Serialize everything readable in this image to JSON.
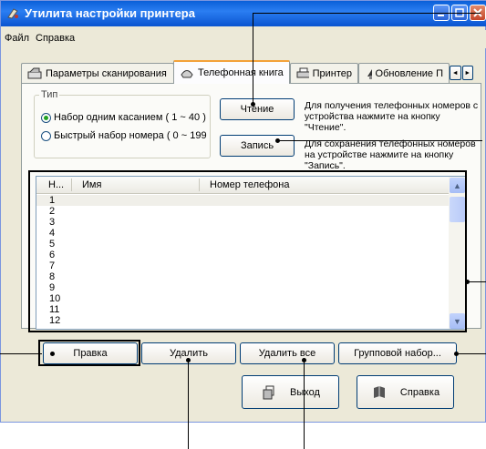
{
  "window": {
    "title": "Утилита настройки принтера"
  },
  "menu": [
    "Файл",
    "Справка"
  ],
  "tabs": [
    {
      "label": "Параметры сканирования",
      "icon": "scanner-icon"
    },
    {
      "label": "Телефонная книга",
      "icon": "phonebook-icon",
      "active": true
    },
    {
      "label": "Принтер",
      "icon": "printer-icon"
    },
    {
      "label": "Обновление П",
      "icon": "update-icon"
    }
  ],
  "tab_scroll": {
    "left": "◄",
    "right": "►"
  },
  "type_group": {
    "label": "Тип",
    "options": [
      {
        "label": "Набор одним касанием ( 1 ~ 40 )",
        "selected": true
      },
      {
        "label": "Быстрый набор номера ( 0 ~ 199",
        "selected": false
      }
    ]
  },
  "buttons": {
    "read": "Чтение",
    "write": "Запись",
    "edit": "Правка",
    "delete": "Удалить",
    "delete_all": "Удалить все",
    "group_dial": "Групповой набор...",
    "exit": "Выход",
    "help": "Справка"
  },
  "descriptions": {
    "read": [
      "Для получения телефонных номеров с",
      "устройства нажмите на кнопку",
      "\"Чтение\"."
    ],
    "write": [
      "Для сохранения телефонных номеров",
      "на устройстве нажмите на кнопку",
      "\"Запись\"."
    ]
  },
  "list": {
    "columns": [
      "Н...",
      "Имя",
      "Номер телефона"
    ],
    "rows": [
      "1",
      "2",
      "3",
      "4",
      "5",
      "6",
      "7",
      "8",
      "9",
      "10",
      "11",
      "12"
    ]
  },
  "scrollbar": {
    "up": "▲",
    "down": "▼"
  },
  "colors": {
    "titlebar": "#0a5fd8",
    "highlight_row": "#f0efe9",
    "tab_accent": "#f3a23a"
  }
}
